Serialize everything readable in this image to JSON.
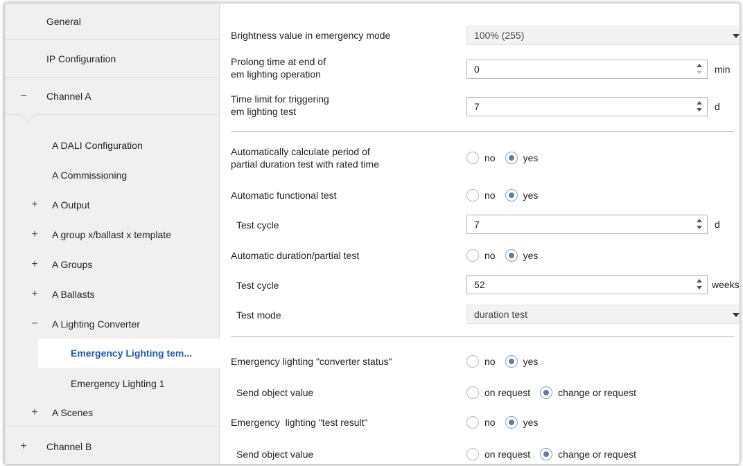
{
  "sidebar": {
    "general": "General",
    "ip_config": "IP Configuration",
    "channel_a": {
      "sign": "−",
      "label": "Channel A"
    },
    "items_l2": [
      {
        "sign": "",
        "label": "A DALI Configuration"
      },
      {
        "sign": "",
        "label": "A Commissioning"
      },
      {
        "sign": "+",
        "label": "A Output"
      },
      {
        "sign": "+",
        "label": "A group x/ballast x template"
      },
      {
        "sign": "+",
        "label": "A Groups"
      },
      {
        "sign": "+",
        "label": "A Ballasts"
      },
      {
        "sign": "−",
        "label": "A Lighting Converter"
      }
    ],
    "items_l3": [
      {
        "label": "Emergency Lighting tem..."
      },
      {
        "label": "Emergency Lighting 1"
      }
    ],
    "scenes": {
      "sign": "+",
      "label": "A Scenes"
    },
    "channel_b": {
      "sign": "+",
      "label": "Channel B"
    }
  },
  "main": {
    "brightness": {
      "label": "Brightness value in emergency mode",
      "value": "100% (255)"
    },
    "prolong": {
      "label1": "Prolong time at end of",
      "label2": "em lighting operation",
      "value": "0",
      "unit": "min"
    },
    "time_limit": {
      "label1": "Time limit for triggering",
      "label2": "em lighting test",
      "value": "7",
      "unit": "d"
    },
    "auto_calc": {
      "label1": "Automatically calculate period of",
      "label2": "partial duration test with rated time",
      "opt_no": "no",
      "opt_yes": "yes"
    },
    "auto_functional": {
      "label": "Automatic functional test",
      "opt_no": "no",
      "opt_yes": "yes"
    },
    "test_cycle_1": {
      "label": "Test cycle",
      "value": "7",
      "unit": "d"
    },
    "auto_duration": {
      "label": "Automatic duration/partial test",
      "opt_no": "no",
      "opt_yes": "yes"
    },
    "test_cycle_2": {
      "label": "Test cycle",
      "value": "52",
      "unit": "weeks"
    },
    "test_mode": {
      "label": "Test mode",
      "value": "duration test"
    },
    "converter_status": {
      "label": "Emergency lighting \"converter status\"",
      "opt_no": "no",
      "opt_yes": "yes"
    },
    "send_value_1": {
      "label": "Send object value",
      "opt_a": "on request",
      "opt_b": "change or request"
    },
    "test_result": {
      "label": "Emergency  lighting \"test result\"",
      "opt_no": "no",
      "opt_yes": "yes"
    },
    "send_value_2": {
      "label": "Send object value",
      "opt_a": "on request",
      "opt_b": "change or request"
    }
  }
}
